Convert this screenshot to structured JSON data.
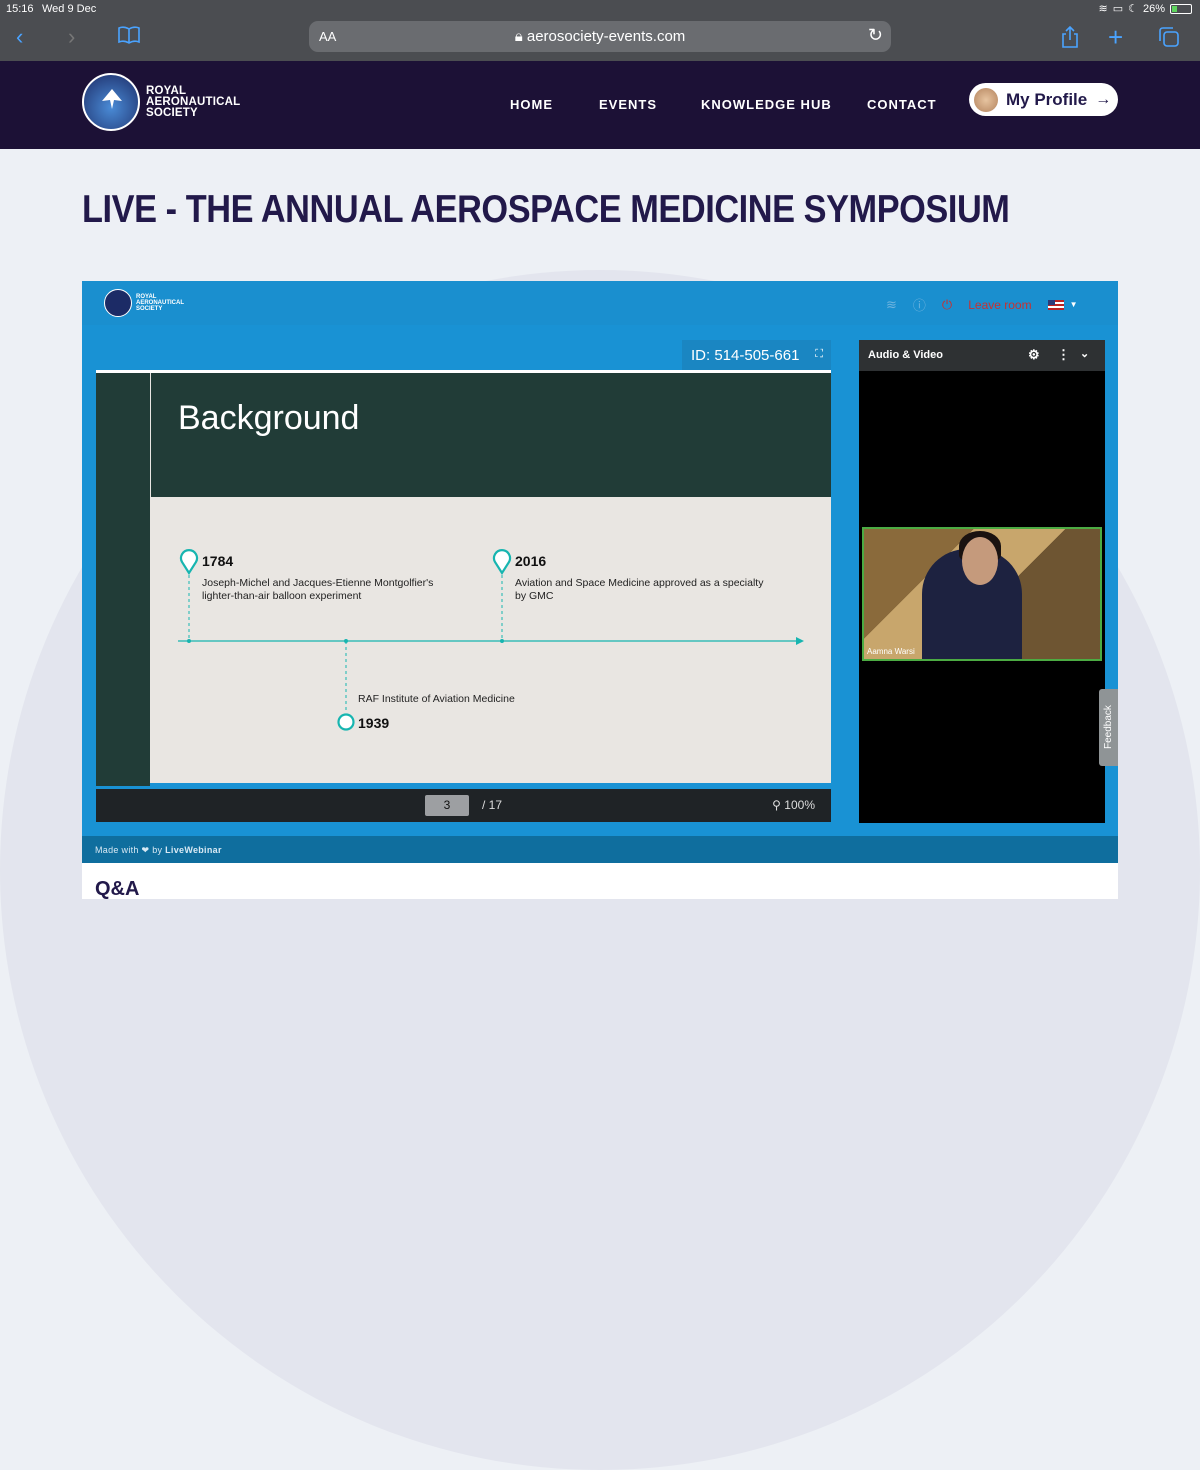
{
  "status": {
    "time": "15:16",
    "date": "Wed 9 Dec",
    "battery": "26%"
  },
  "browser": {
    "aa": "AA",
    "url": "aerosociety-events.com"
  },
  "site": {
    "logo_line1": "ROYAL",
    "logo_line2": "AERONAUTICAL",
    "logo_line3": "SOCIETY",
    "nav": [
      "HOME",
      "EVENTS",
      "KNOWLEDGE HUB",
      "CONTACT"
    ],
    "profile_label": "My Profile",
    "profile_arrow": "→"
  },
  "page": {
    "title": "LIVE - THE ANNUAL AEROSPACE MEDICINE SYMPOSIUM"
  },
  "webinar": {
    "logo_line1": "ROYAL",
    "logo_line2": "AERONAUTICAL",
    "logo_line3": "SOCIETY",
    "leave_label": "Leave room",
    "room_id": "ID: 514-505-661",
    "slide": {
      "title": "Background",
      "events": [
        {
          "year": "1784",
          "desc1": "Joseph-Michel and Jacques-Etienne Montgolfier's",
          "desc2": "lighter-than-air balloon experiment"
        },
        {
          "year": "2016",
          "desc1": "Aviation and Space Medicine approved as a specialty",
          "desc2": "by GMC"
        },
        {
          "year": "1939",
          "desc1": "RAF Institute of Aviation Medicine",
          "desc2": ""
        }
      ]
    },
    "page_current": "3",
    "page_total": "/ 17",
    "zoom": "100%",
    "av_title": "Audio & Video",
    "participant": "Aamna Warsi",
    "feedback": "Feedback",
    "footer_made": "Made with",
    "footer_by": "by",
    "footer_brand": "LiveWebinar"
  },
  "qa": {
    "title": "Q&A"
  },
  "colors": {
    "navy": "#1c1136",
    "webinar_blue": "#1992d4",
    "slide_green": "#213c37",
    "accent_teal": "#17b5b0"
  }
}
